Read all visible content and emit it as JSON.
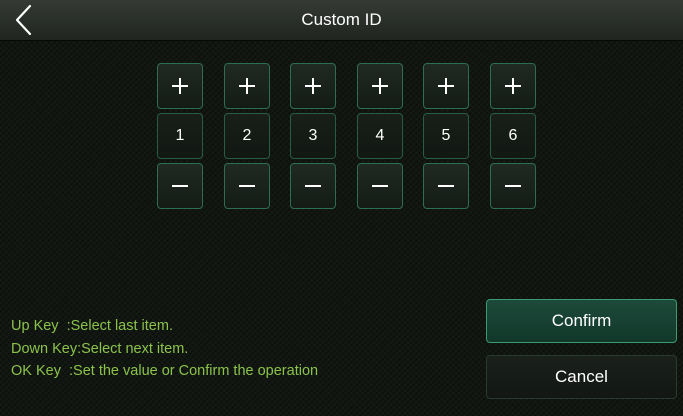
{
  "header": {
    "title": "Custom ID"
  },
  "digits": [
    {
      "plus_label": "+",
      "value": "1",
      "minus_label": "−"
    },
    {
      "plus_label": "+",
      "value": "2",
      "minus_label": "−"
    },
    {
      "plus_label": "+",
      "value": "3",
      "minus_label": "−"
    },
    {
      "plus_label": "+",
      "value": "4",
      "minus_label": "−"
    },
    {
      "plus_label": "+",
      "value": "5",
      "minus_label": "−"
    },
    {
      "plus_label": "+",
      "value": "6",
      "minus_label": "−"
    }
  ],
  "help": {
    "up": "Up Key  :Select last item.",
    "down": "Down Key:Select next item.",
    "ok": "OK Key  :Set the value or Confirm the operation"
  },
  "buttons": {
    "confirm": "Confirm",
    "cancel": "Cancel"
  },
  "colors": {
    "help_text": "#8bc34a",
    "accent_border": "#3a9a72",
    "confirm_bg": "#1d4a3a"
  },
  "icons": {
    "back": "chevron-left-icon",
    "increment": "plus-icon",
    "decrement": "minus-icon"
  }
}
